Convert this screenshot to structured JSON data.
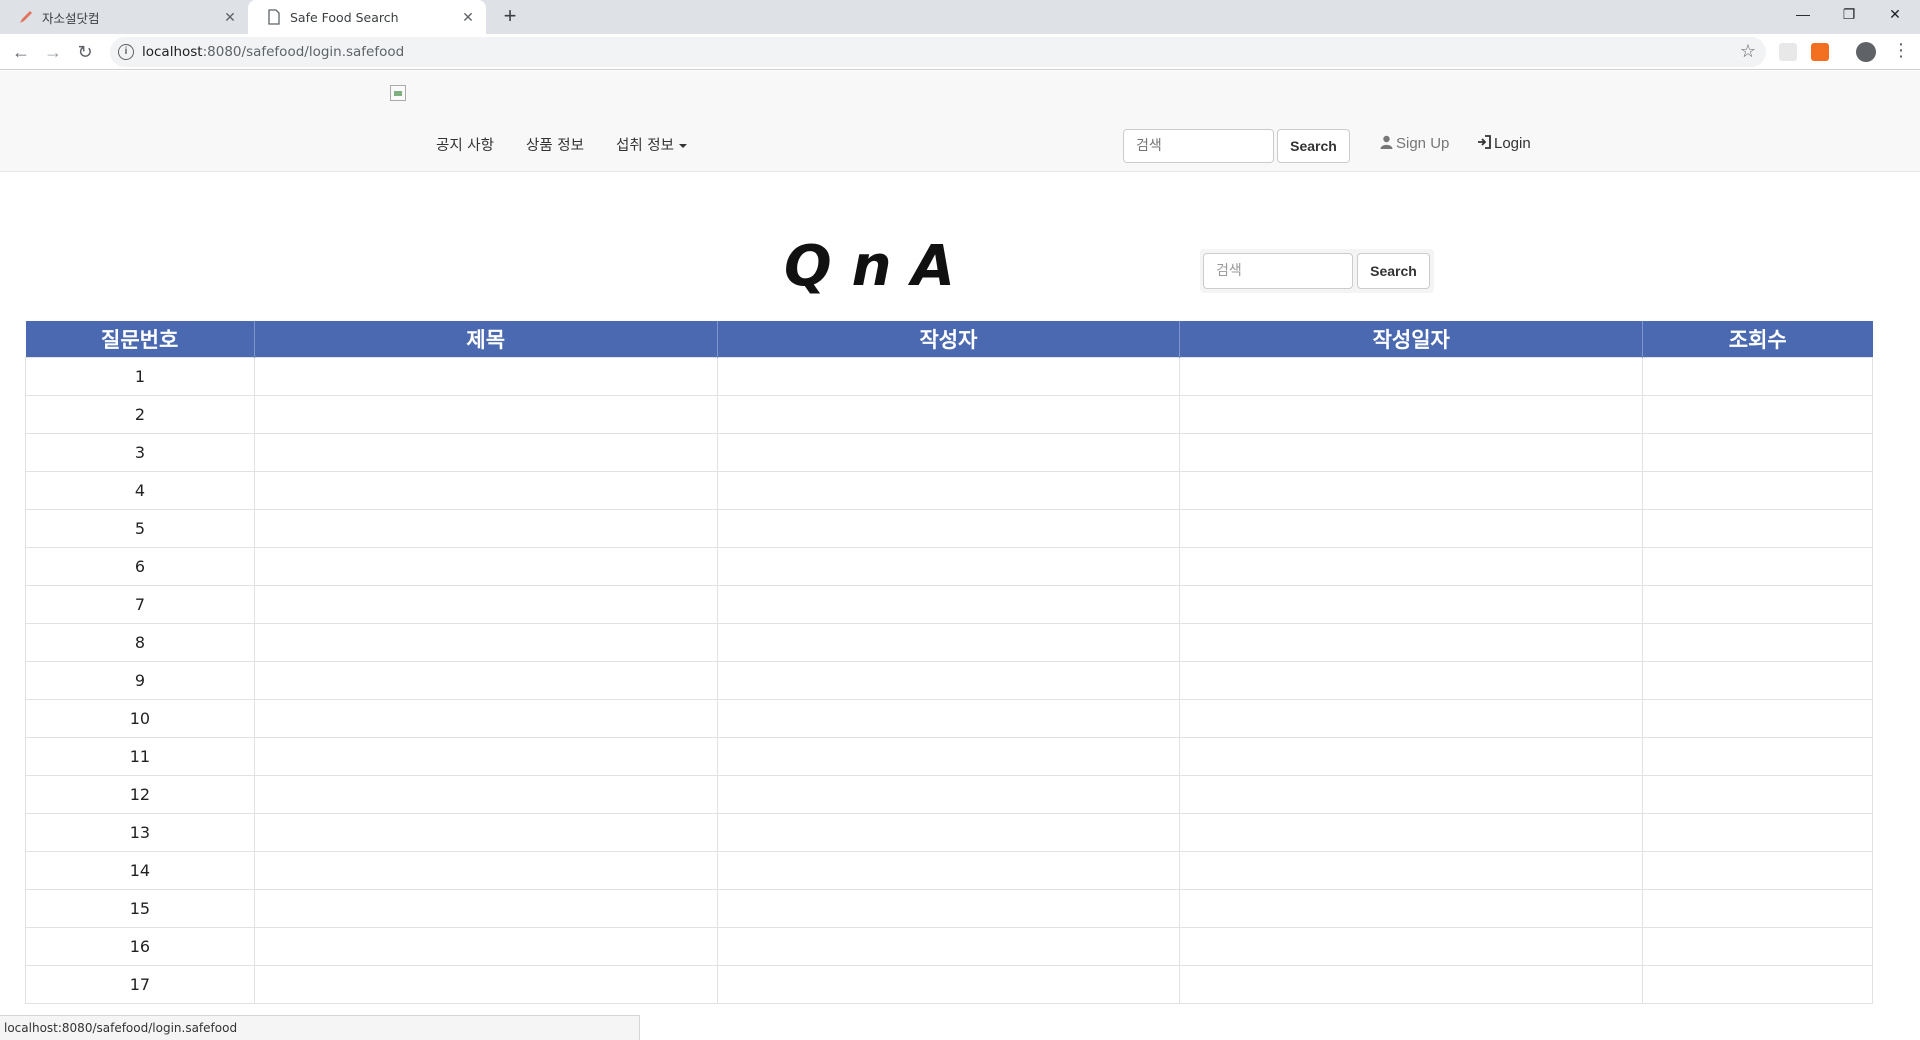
{
  "browser": {
    "tabs": [
      {
        "title": "자소설닷컴",
        "active": false
      },
      {
        "title": "Safe Food Search",
        "active": true
      }
    ],
    "url_host": "localhost",
    "url_path": ":8080/safefood/login.safefood",
    "status_url": "localhost:8080/safefood/login.safefood"
  },
  "navbar": {
    "links": [
      "공지 사항",
      "상품 정보",
      "섭취 정보"
    ],
    "search_placeholder": "검색",
    "search_button": "Search",
    "signup_label": "Sign Up",
    "login_label": "Login"
  },
  "qna": {
    "title": "QnA",
    "search_placeholder": "검색",
    "search_button": "Search"
  },
  "table": {
    "headers": [
      "질문번호",
      "제목",
      "작성자",
      "작성일자",
      "조회수"
    ],
    "rows": [
      [
        "1",
        "",
        "",
        "",
        ""
      ],
      [
        "2",
        "",
        "",
        "",
        ""
      ],
      [
        "3",
        "",
        "",
        "",
        ""
      ],
      [
        "4",
        "",
        "",
        "",
        ""
      ],
      [
        "5",
        "",
        "",
        "",
        ""
      ],
      [
        "6",
        "",
        "",
        "",
        ""
      ],
      [
        "7",
        "",
        "",
        "",
        ""
      ],
      [
        "8",
        "",
        "",
        "",
        ""
      ],
      [
        "9",
        "",
        "",
        "",
        ""
      ],
      [
        "10",
        "",
        "",
        "",
        ""
      ],
      [
        "11",
        "",
        "",
        "",
        ""
      ],
      [
        "12",
        "",
        "",
        "",
        ""
      ],
      [
        "13",
        "",
        "",
        "",
        ""
      ],
      [
        "14",
        "",
        "",
        "",
        ""
      ],
      [
        "15",
        "",
        "",
        "",
        ""
      ],
      [
        "16",
        "",
        "",
        "",
        ""
      ],
      [
        "17",
        "",
        "",
        "",
        ""
      ]
    ]
  },
  "colors": {
    "table_header": "#4a69b1",
    "navbar_bg": "#f8f8f8",
    "tab_strip": "#dee1e6"
  }
}
